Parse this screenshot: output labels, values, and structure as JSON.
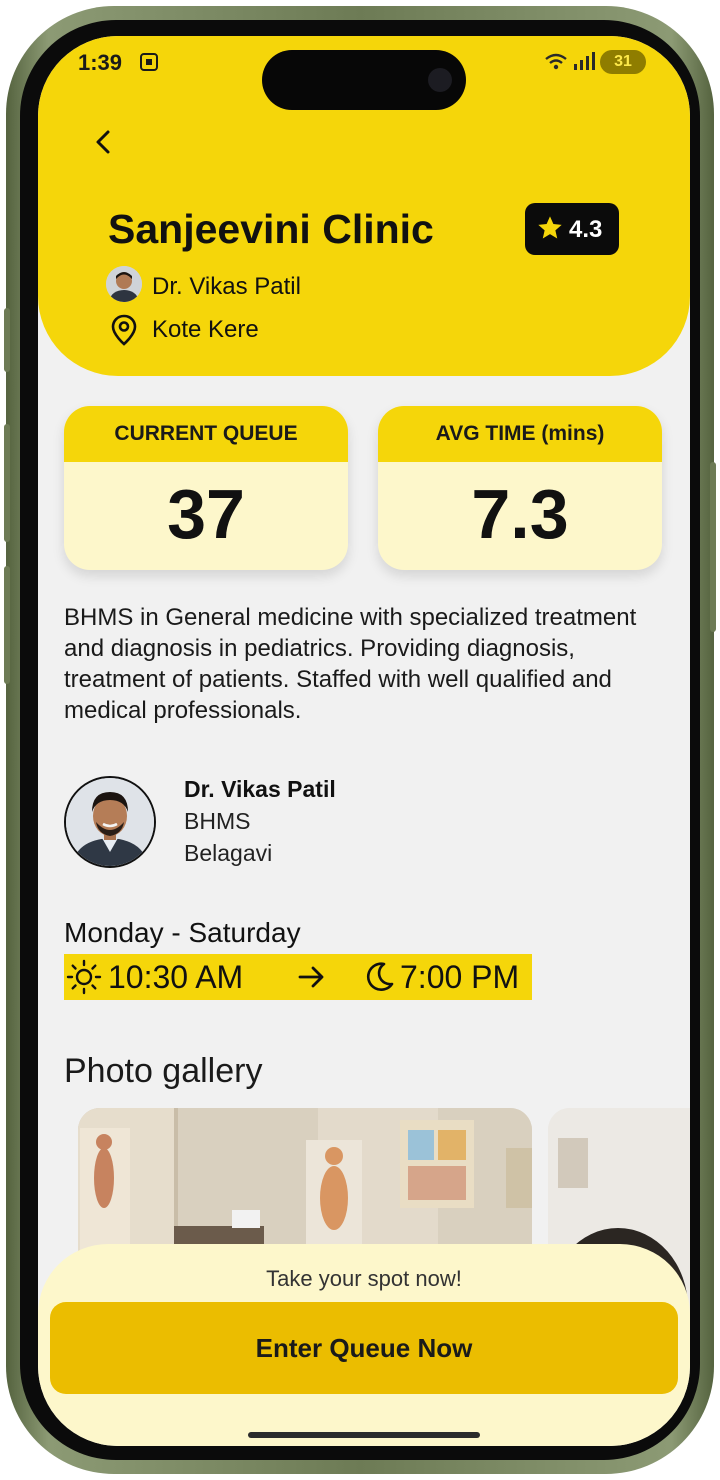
{
  "status_bar": {
    "time": "1:39",
    "battery": "31"
  },
  "clinic": {
    "name": "Sanjeevini Clinic",
    "rating": "4.3",
    "doctor": "Dr. Vikas Patil",
    "location": "Kote Kere"
  },
  "stats": {
    "queue_label": "CURRENT QUEUE",
    "queue_value": "37",
    "avg_label": "AVG TIME (mins)",
    "avg_value": "7.3"
  },
  "description": "BHMS in General medicine with specialized treatment and diagnosis in pediatrics. Providing diagnosis, treatment of patients. Staffed with well qualified and medical professionals.",
  "doctor_card": {
    "name": "Dr. Vikas Patil",
    "degree": "BHMS",
    "city": "Belagavi"
  },
  "hours": {
    "days": "Monday - Saturday",
    "open": "10:30 AM",
    "close": "7:00 PM"
  },
  "gallery": {
    "title": "Photo gallery"
  },
  "cta": {
    "hint": "Take your spot now!",
    "button_label": "Enter Queue Now"
  },
  "colors": {
    "accent": "#f5d60a",
    "card_bg": "#fdf7cb",
    "button": "#ebbd00",
    "screen_bg": "#f1f1f1"
  },
  "icons": [
    "back-arrow-icon",
    "star-icon",
    "location-pin-icon",
    "sun-icon",
    "arrow-right-icon",
    "moon-icon",
    "wifi-icon",
    "signal-icon",
    "battery-icon",
    "screen-record-icon"
  ]
}
